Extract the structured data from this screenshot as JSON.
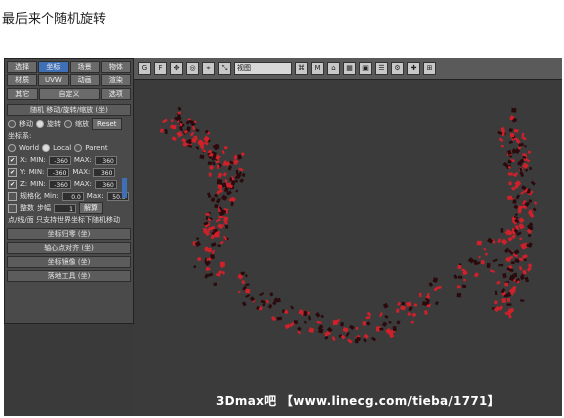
{
  "caption": "最后来个随机旋转",
  "toolbar": {
    "select_label": "视图",
    "buttons": [
      "G",
      "F",
      "✥",
      "◎",
      "⌖",
      "⤡",
      "⌘",
      "M",
      "⌂",
      "▦",
      "▣",
      "☰",
      "⚙",
      "✚",
      "⊞"
    ]
  },
  "panel": {
    "tabs_row1": [
      "选择",
      "坐标",
      "场景",
      "物体"
    ],
    "tabs_row2": [
      "材质",
      "UVW",
      "动画",
      "渲染"
    ],
    "tabs_row3": [
      "其它",
      "自定义",
      "选项"
    ],
    "active_tab": "坐标",
    "rollout_title": "随机 移动/旋转/缩放 (坐)",
    "mode": {
      "move": "移动",
      "rotate": "旋转",
      "scale": "缩放",
      "reset": "Reset"
    },
    "coord_label": "坐标系:",
    "coord_options": [
      "World",
      "Local",
      "Parent"
    ],
    "axes": [
      {
        "axis": "X:",
        "min_label": "MIN:",
        "min": "-360",
        "max_label": "MAX:",
        "max": "360"
      },
      {
        "axis": "Y:",
        "min_label": "MIN:",
        "min": "-360",
        "max_label": "MAX:",
        "max": "360"
      },
      {
        "axis": "Z:",
        "min_label": "MIN:",
        "min": "-360",
        "max_label": "MAX:",
        "max": "360"
      }
    ],
    "proportional": {
      "label": "规格化",
      "min_label": "Min:",
      "min": "0.0",
      "max_label": "Max:",
      "max": "50.0"
    },
    "integer": {
      "label": "整数",
      "step_label": "步幅",
      "step": "1",
      "solve": "解算"
    },
    "note": "点/线/面 只支持世界坐标下随机移动",
    "collapsed": [
      "坐标归零 (坐)",
      "轴心点对齐 (坐)",
      "坐标镜像 (坐)",
      "落地工具 (坐)"
    ]
  },
  "watermark": "3Dmax吧 【www.linecg.com/tieba/1771】"
}
